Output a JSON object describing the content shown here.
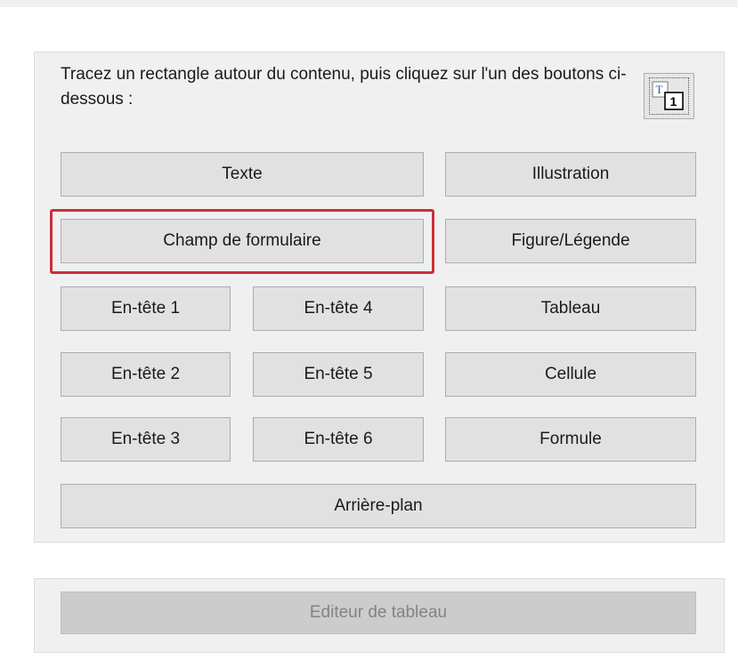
{
  "instruction": "Tracez un rectangle autour du contenu, puis cliquez sur l'un des boutons ci-dessous :",
  "buttons": {
    "texte": "Texte",
    "illustration": "Illustration",
    "champ_formulaire": "Champ de formulaire",
    "figure_legende": "Figure/Légende",
    "entete1": "En-tête 1",
    "entete2": "En-tête 2",
    "entete3": "En-tête 3",
    "entete4": "En-tête 4",
    "entete5": "En-tête 5",
    "entete6": "En-tête 6",
    "tableau": "Tableau",
    "cellule": "Cellule",
    "formule": "Formule",
    "arriere_plan": "Arrière-plan",
    "editeur_tableau": "Editeur de tableau"
  },
  "icon": {
    "tag_order": "tag-order-icon",
    "glyph_t": "T",
    "glyph_1": "1"
  },
  "colors": {
    "highlight": "#c8303a",
    "panel": "#f0f0f0",
    "button": "#e1e1e1"
  }
}
